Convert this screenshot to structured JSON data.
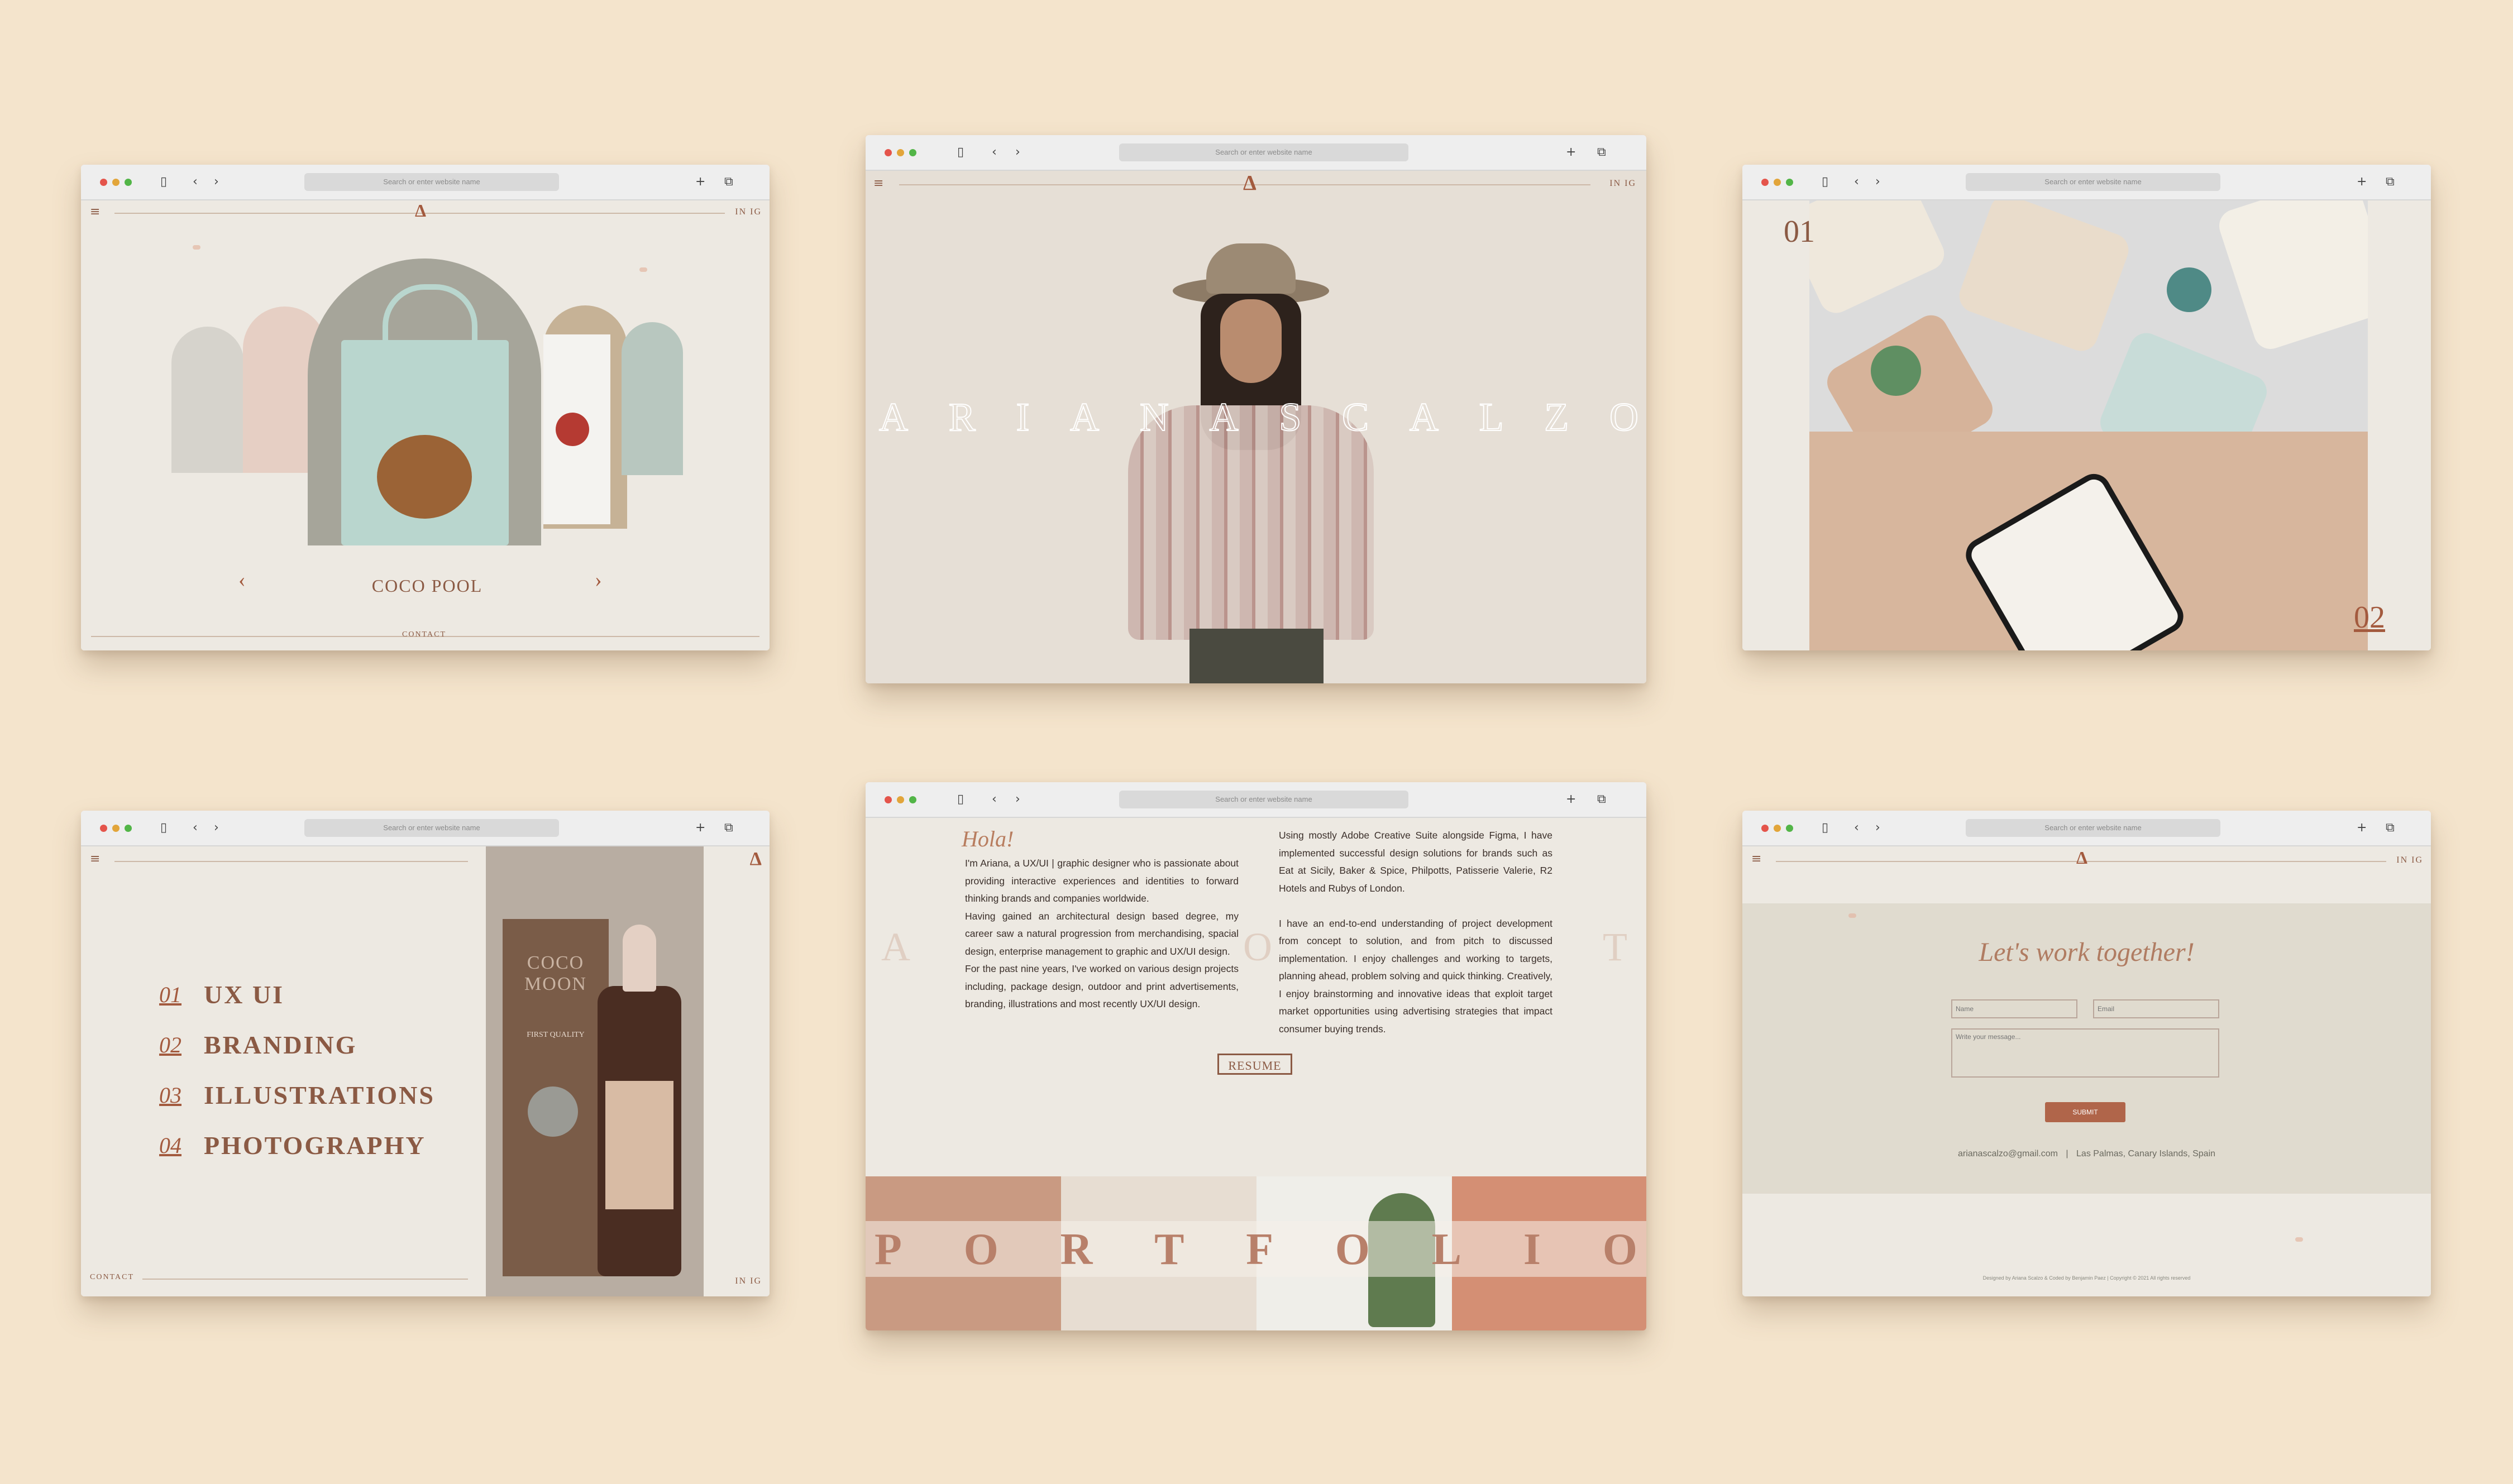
{
  "browser": {
    "url_placeholder": "Search or enter website name",
    "social": "IN  IG",
    "logo": "Δ"
  },
  "w1": {
    "title": "COCO POOL",
    "contact": "CONTACT",
    "prev": "‹",
    "next": "›"
  },
  "w2": {
    "name_letters": [
      "A",
      "R",
      "I",
      "A",
      "N",
      "A",
      "S",
      "C",
      "A",
      "L",
      "Z",
      "O"
    ]
  },
  "w3": {
    "num1": "01",
    "num2": "02"
  },
  "w4": {
    "items": [
      {
        "num": "01",
        "label": "UX UI"
      },
      {
        "num": "02",
        "label": "BRANDING"
      },
      {
        "num": "03",
        "label": "ILLUSTRATIONS"
      },
      {
        "num": "04",
        "label": "PHOTOGRAPHY"
      }
    ],
    "contact": "CONTACT",
    "product_brand": "COCO MOON",
    "product_label": "FIRST QUALITY"
  },
  "w5": {
    "greeting": "Hola!",
    "para_left": "I'm Ariana, a UX/UI | graphic designer who is passionate about providing interactive experiences and identities to forward thinking brands and companies worldwide.\nHaving gained an architectural design based degree, my career saw a natural progression from merchandising, spacial design, enterprise management to graphic and UX/UI design.\nFor the past nine years, I've worked on various design projects including, package design, outdoor and print advertisements, branding, illustrations and most recently UX/UI design.",
    "para_right": "Using mostly Adobe Creative Suite alongside Figma, I have implemented successful design solutions for brands such as Eat at Sicily, Baker & Spice, Philpotts, Patisserie Valerie, R2 Hotels and Rubys of London.\n\nI have an end-to-end understanding of project development from concept to solution, and from pitch to discussed implementation. I enjoy challenges and working to targets, planning ahead, problem solving and quick thinking. Creatively, I enjoy brainstorming and innovative ideas that exploit target market opportunities using advertising strategies that impact consumer buying trends.",
    "bg_letters": [
      "A",
      "O",
      "T"
    ],
    "resume": "RESUME",
    "portfolio_letters": [
      "P",
      "O",
      "R",
      "T",
      "F",
      "O",
      "L",
      "I",
      "O"
    ]
  },
  "w6": {
    "heading": "Let's work together!",
    "name_placeholder": "Name",
    "email_placeholder": "Email",
    "message_placeholder": "Write your message...",
    "submit": "SUBMIT",
    "email": "arianascalzo@gmail.com",
    "location": "Las Palmas, Canary Islands, Spain",
    "footer": "Designed by Ariana Scalzo & Coded by Benjamin Paez | Copyright © 2021 All rights reserved"
  },
  "colors": {
    "background": "#f4e4cc",
    "accent": "#a35a3e",
    "tan": "#d8b59c",
    "panel": "#ede9e2"
  }
}
